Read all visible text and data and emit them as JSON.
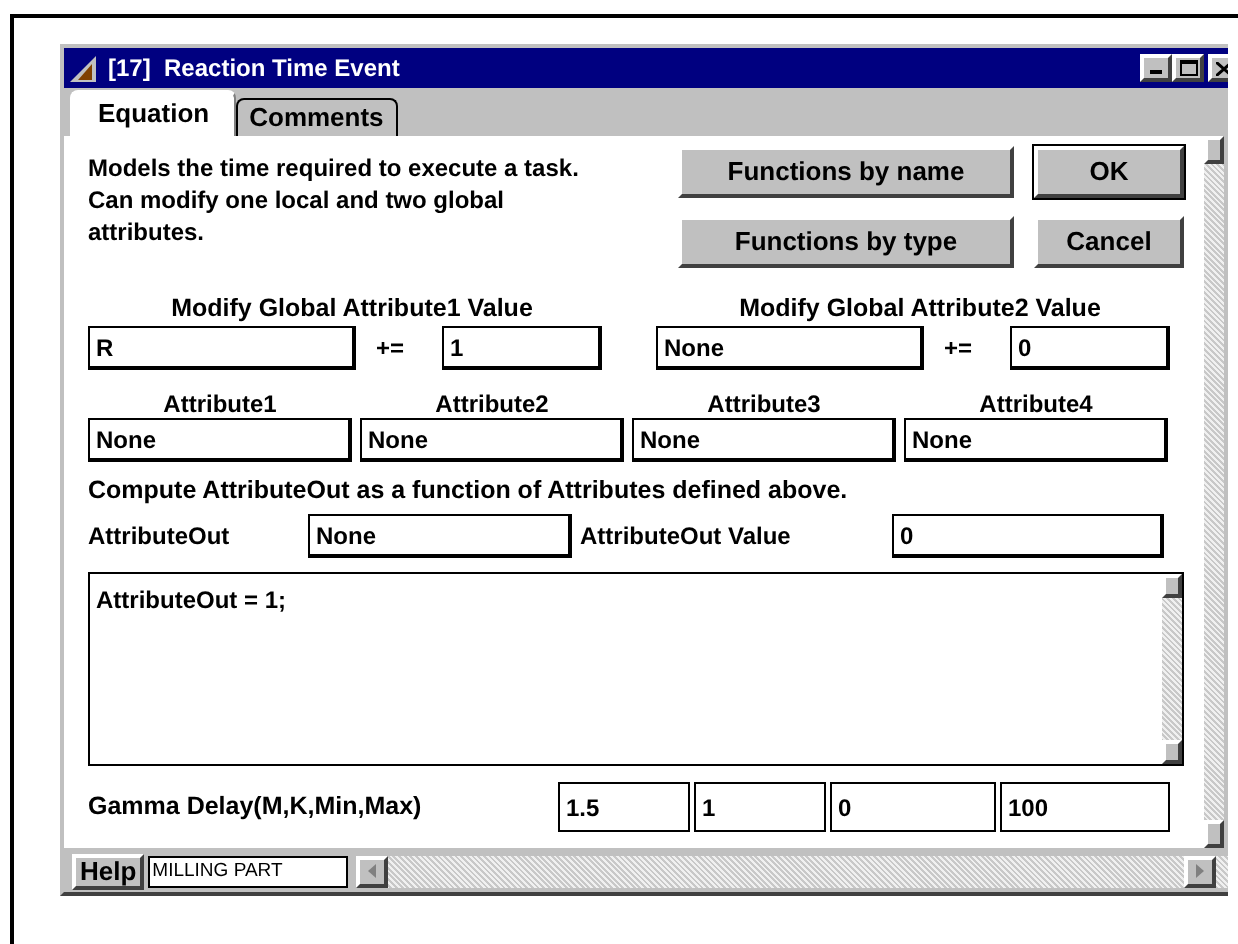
{
  "window": {
    "title": "[17]  Reaction Time Event"
  },
  "tabs": [
    {
      "label": "Equation",
      "selected": true
    },
    {
      "label": "Comments",
      "selected": false
    }
  ],
  "description": "Models the time required to execute a task.   Can modify one local and two global attributes.",
  "buttons": [
    {
      "label": "Functions by name",
      "default": false
    },
    {
      "label": "OK",
      "default": true
    },
    {
      "label": "Functions by type",
      "default": false
    },
    {
      "label": "Cancel",
      "default": false
    }
  ],
  "global_attributes": [
    {
      "label": "Modify Global Attribute1 Value",
      "attribute": "R",
      "operator": "+=",
      "value": "1"
    },
    {
      "label": "Modify Global Attribute2 Value",
      "attribute": "None",
      "operator": "+=",
      "value": "0"
    }
  ],
  "attributes": [
    {
      "label": "Attribute1",
      "value": "None"
    },
    {
      "label": "Attribute2",
      "value": "None"
    },
    {
      "label": "Attribute3",
      "value": "None"
    },
    {
      "label": "Attribute4",
      "value": "None"
    }
  ],
  "compute_text": "Compute AttributeOut as a function of Attributes defined above.",
  "attribute_out": {
    "label": "AttributeOut",
    "value": "None",
    "value_label": "AttributeOut Value",
    "out_value": "0"
  },
  "equation": "AttributeOut = 1;",
  "gamma_delay": {
    "label": "Gamma Delay(M,K,Min,Max)",
    "values": [
      "1.5",
      "1",
      "0",
      "100"
    ]
  },
  "status_bar": {
    "help": "Help",
    "status": "MILLING PART"
  }
}
